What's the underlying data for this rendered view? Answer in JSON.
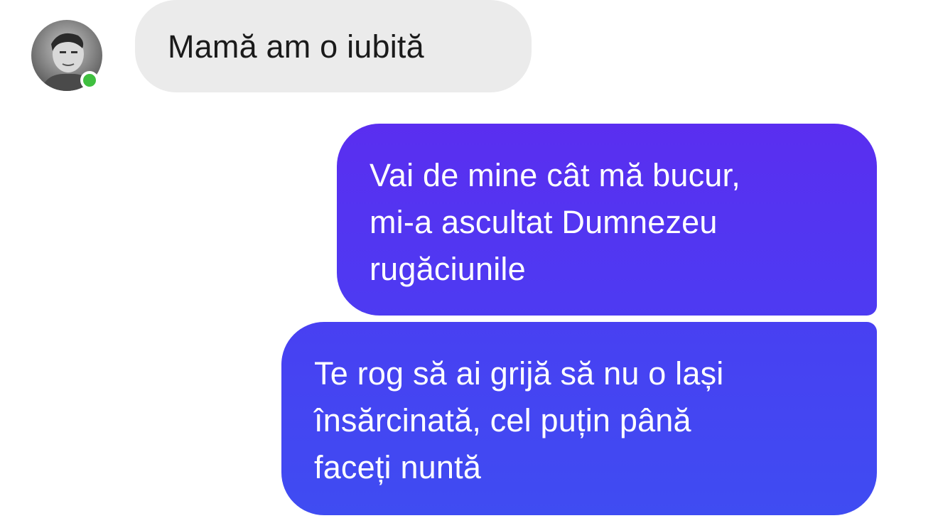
{
  "conversation": {
    "contact": {
      "avatar_icon": "person-avatar-icon",
      "online_status_color": "#3fbf3f"
    },
    "messages": [
      {
        "direction": "incoming",
        "lines": [
          "Mamă am o iubită"
        ]
      },
      {
        "direction": "outgoing",
        "lines": [
          "Vai de mine cât mă bucur,",
          "mi-a ascultat Dumnezeu",
          "rugăciunile"
        ]
      },
      {
        "direction": "outgoing",
        "lines": [
          "Te rog să ai grijă să nu o lași",
          "însărcinată, cel puțin până",
          "faceți nuntă"
        ]
      }
    ]
  },
  "colors": {
    "incoming_bubble": "#ebebeb",
    "outgoing_bubble_top": "#5a2ef0",
    "outgoing_bubble_bottom": "#3f4cf2"
  }
}
